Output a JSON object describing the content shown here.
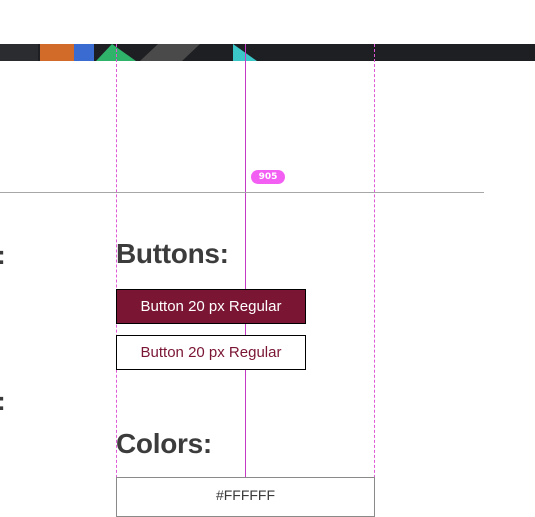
{
  "hero": {
    "blocks": [
      {
        "color": "#2c3a4a"
      },
      {
        "color": "#d26a2a"
      },
      {
        "color": "#3a6bd1"
      },
      {
        "color": "#2fb36b"
      },
      {
        "color": "#e8e8e8"
      },
      {
        "color": "#5a5a5a"
      },
      {
        "color": "#3bc7c7"
      }
    ]
  },
  "measure": {
    "label": "905"
  },
  "sections": {
    "buttons_heading": "Buttons:",
    "colors_heading": "Colors:",
    "edge_colon_1": ":",
    "edge_colon_2": ":"
  },
  "buttons": {
    "primary_label": "Button 20 px Regular",
    "outline_label": "Button 20 px Regular"
  },
  "colors": {
    "swatch_label": "#FFFFFF",
    "brand_primary": "#7a1534",
    "guide_color": "#e05ad8"
  }
}
